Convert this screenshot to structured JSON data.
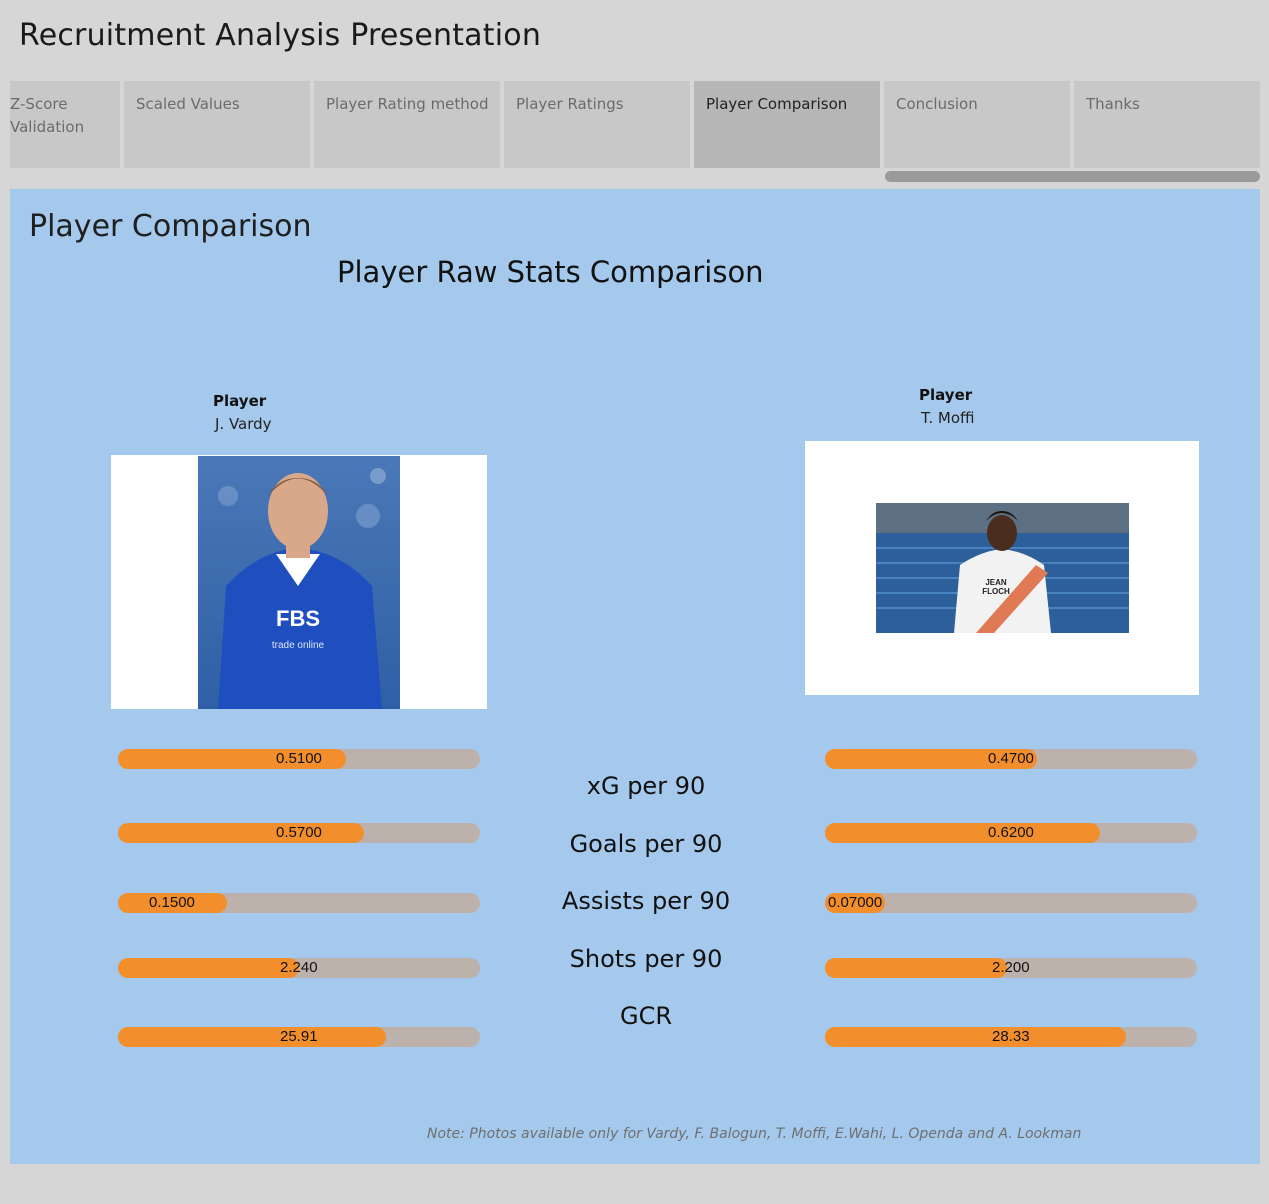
{
  "app": {
    "title": "Recruitment Analysis Presentation"
  },
  "tabs": [
    {
      "label": "Z-Score\nValidation",
      "active": false
    },
    {
      "label": "Scaled Values",
      "active": false
    },
    {
      "label": "Player Rating method",
      "active": false
    },
    {
      "label": "Player Ratings",
      "active": false
    },
    {
      "label": "Player Comparison",
      "active": true
    },
    {
      "label": "Conclusion",
      "active": false
    },
    {
      "label": "Thanks",
      "active": false
    }
  ],
  "panel": {
    "heading": "Player Comparison",
    "chart_title": "Player Raw Stats Comparison",
    "note": "Note: Photos available only for Vardy, F. Balogun, T. Moffi, E.Wahi, L. Openda and A. Lookman"
  },
  "players": {
    "left": {
      "label": "Player",
      "name": "J. Vardy",
      "photo_icon": "player-photo-jersey-blue"
    },
    "right": {
      "label": "Player",
      "name": "T. Moffi",
      "photo_icon": "player-photo-jersey-white"
    }
  },
  "colors": {
    "bar_fill": "#f28f2c",
    "bar_track": "#bdb1ab",
    "panel_bg": "#a4c9ec"
  },
  "chart_data": {
    "type": "bar",
    "categories": [
      "xG per 90",
      "Goals per 90",
      "Assists per 90",
      "Shots per 90",
      "GCR"
    ],
    "series": [
      {
        "name": "J. Vardy",
        "values": [
          0.51,
          0.57,
          0.15,
          2.24,
          25.91
        ],
        "labels": [
          "0.5100",
          "0.5700",
          "0.1500",
          "2.240",
          "25.91"
        ],
        "fill_fraction": [
          0.63,
          0.68,
          0.3,
          0.5,
          0.74
        ]
      },
      {
        "name": "T. Moffi",
        "values": [
          0.47,
          0.62,
          0.07,
          2.2,
          28.33
        ],
        "labels": [
          "0.4700",
          "0.6200",
          "0.07000",
          "2.200",
          "28.33"
        ],
        "fill_fraction": [
          0.57,
          0.74,
          0.16,
          0.49,
          0.81
        ]
      }
    ]
  }
}
